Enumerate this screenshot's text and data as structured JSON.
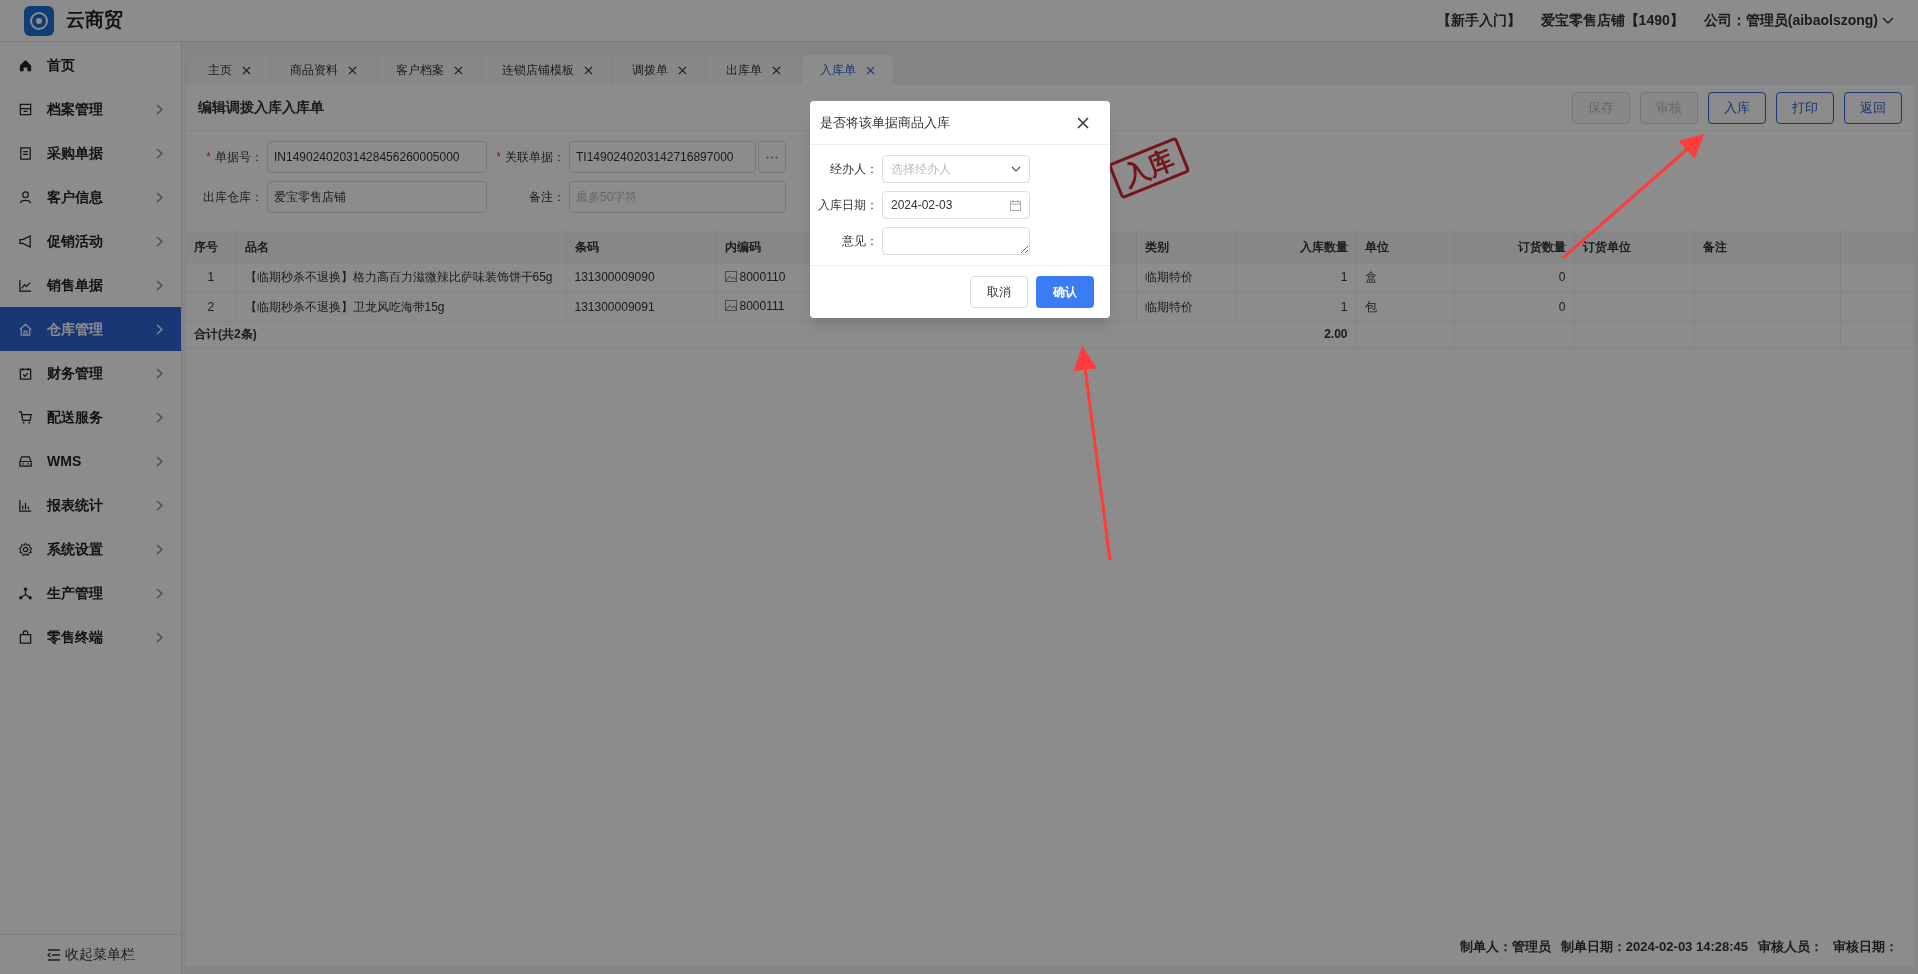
{
  "app": {
    "title": "云商贸"
  },
  "header": {
    "links": [
      "【新手入门】",
      "爱宝零售店铺【1490】"
    ],
    "user": "公司：管理员(aibaolszong)"
  },
  "sidebar": {
    "items": [
      {
        "label": "首页",
        "expandable": false,
        "selected": false
      },
      {
        "label": "档案管理",
        "expandable": true,
        "selected": false
      },
      {
        "label": "采购单据",
        "expandable": true,
        "selected": false
      },
      {
        "label": "客户信息",
        "expandable": true,
        "selected": false
      },
      {
        "label": "促销活动",
        "expandable": true,
        "selected": false
      },
      {
        "label": "销售单据",
        "expandable": true,
        "selected": false
      },
      {
        "label": "仓库管理",
        "expandable": true,
        "selected": true
      },
      {
        "label": "财务管理",
        "expandable": true,
        "selected": false
      },
      {
        "label": "配送服务",
        "expandable": true,
        "selected": false
      },
      {
        "label": "WMS",
        "expandable": true,
        "selected": false
      },
      {
        "label": "报表统计",
        "expandable": true,
        "selected": false
      },
      {
        "label": "系统设置",
        "expandable": true,
        "selected": false
      },
      {
        "label": "生产管理",
        "expandable": true,
        "selected": false
      },
      {
        "label": "零售终端",
        "expandable": true,
        "selected": false
      }
    ],
    "collapse": "收起菜单栏"
  },
  "tabs": [
    {
      "label": "主页",
      "selected": false
    },
    {
      "label": "商品资料",
      "selected": false
    },
    {
      "label": "客户档案",
      "selected": false
    },
    {
      "label": "连锁店铺模板",
      "selected": false
    },
    {
      "label": "调拨单",
      "selected": false
    },
    {
      "label": "出库单",
      "selected": false
    },
    {
      "label": "入库单",
      "selected": true
    }
  ],
  "page": {
    "title": "编辑调拨入库入库单",
    "toolbar": [
      {
        "label": "保存",
        "disabled": true
      },
      {
        "label": "审核",
        "disabled": true
      },
      {
        "label": "入库",
        "disabled": false
      },
      {
        "label": "打印",
        "disabled": false
      },
      {
        "label": "返回",
        "disabled": false
      }
    ],
    "form": [
      {
        "label": "单据号：",
        "mark": "*",
        "value": "IN14902402031428456260005000",
        "more": false
      },
      {
        "label": "关联单据：",
        "mark": "*",
        "value": "TI1490240203142716897000",
        "more": true
      },
      {
        "label": "出库仓库：",
        "value": "爱宝零售店铺",
        "more": false
      },
      {
        "label": "备注：",
        "placeholder": "最多50字符",
        "more": false
      }
    ],
    "stamp": "入库",
    "table": {
      "columns": [
        "序号",
        "品名",
        "条码",
        "内编码",
        "类别",
        "入库数量",
        "单位",
        "订货数量",
        "订货单位",
        "备注"
      ],
      "rows": [
        [
          "1",
          "【临期秒杀不退换】格力高百力滋微辣比萨味装饰饼干65g",
          "131300009090",
          "8000110",
          "临期特价",
          "1",
          "盒",
          "0"
        ],
        [
          "2",
          "【临期秒杀不退换】卫龙风吃海带15g",
          "131300009091",
          "8000111",
          "临期特价",
          "1",
          "包",
          "0"
        ]
      ],
      "total": {
        "label": "合计(共2条)",
        "qty": "2.00"
      }
    },
    "footer": [
      "制单人：管理员",
      "制单日期：2024-02-03 14:28:45",
      "审核人员：",
      "审核日期："
    ]
  },
  "dialog": {
    "title": "是否将该单据商品入库",
    "fields": [
      {
        "kind": "select",
        "label": "经办人：",
        "placeholder": "选择经办人"
      },
      {
        "kind": "date",
        "label": "入库日期：",
        "value": "2024-02-03"
      },
      {
        "kind": "textarea",
        "label": "意见："
      }
    ],
    "buttons": [
      {
        "label": "取消",
        "primary": false
      },
      {
        "label": "确认",
        "primary": true
      }
    ]
  }
}
